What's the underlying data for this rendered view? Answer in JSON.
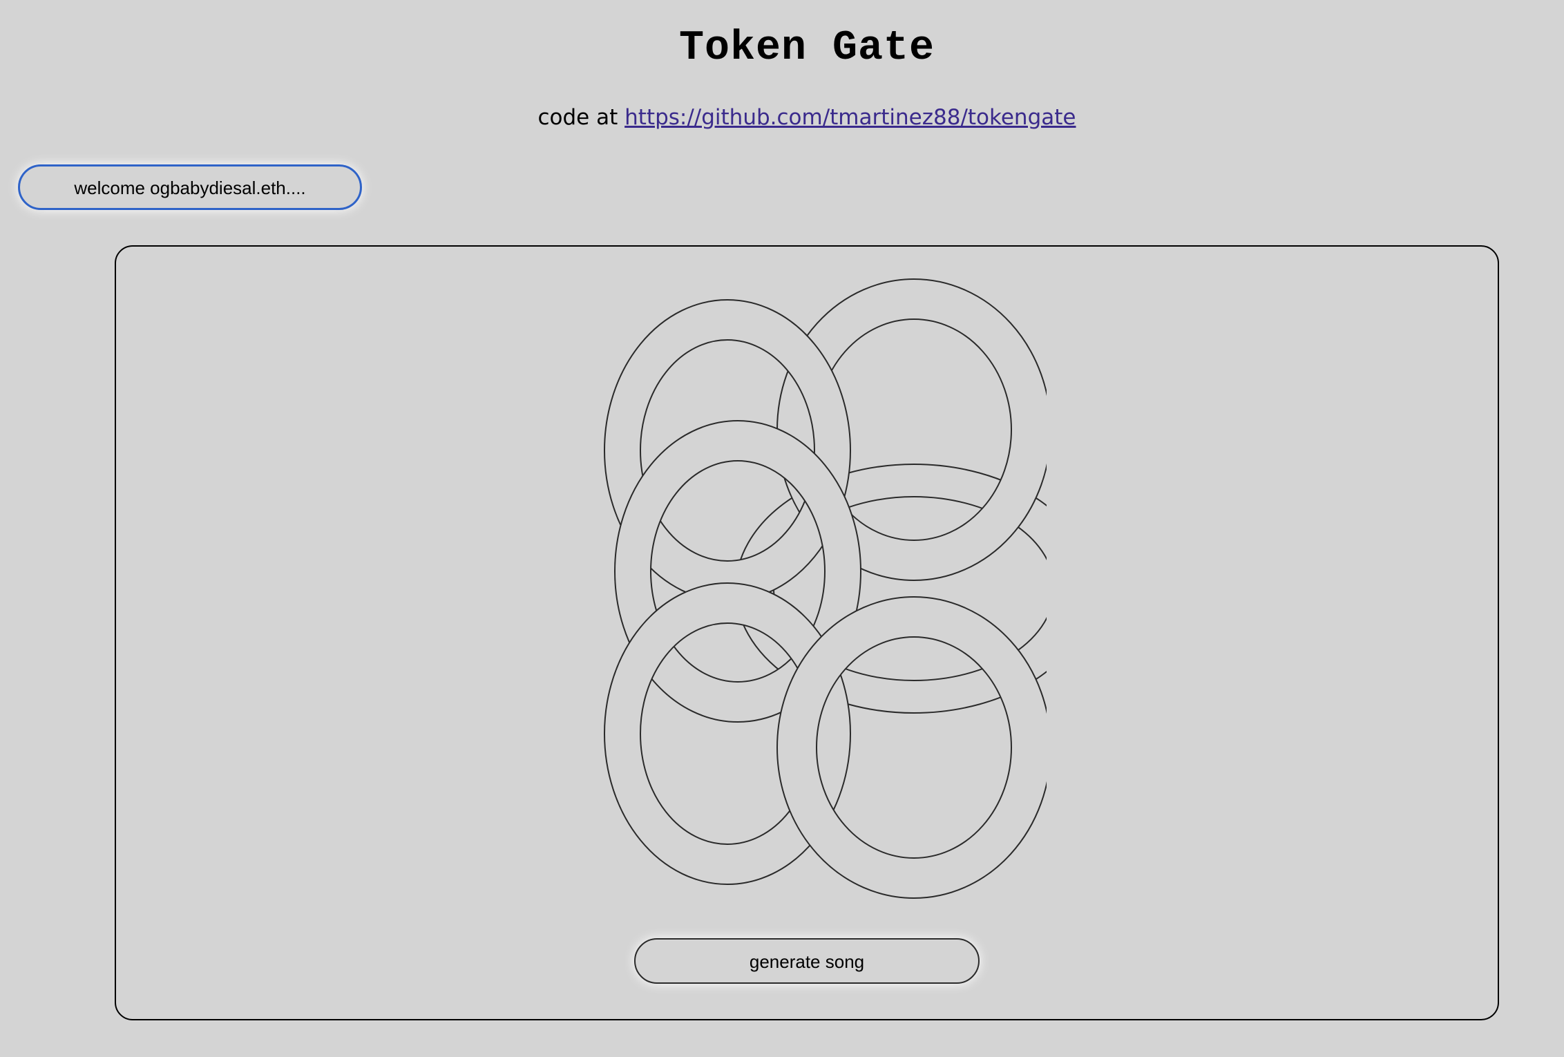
{
  "header": {
    "title": "Token Gate",
    "code_prefix": "code at",
    "repo_link": "https://github.com/tmartinez88/tokengate"
  },
  "account": {
    "welcome_label": "welcome ogbabydiesal.eth...."
  },
  "player": {
    "artwork_icon": "interlocking-rings-icon",
    "generate_label": "generate song"
  },
  "colors": {
    "background": "#d4d4d4",
    "link": "#3a2a8c",
    "welcome_border": "#2f63c8",
    "ring_stroke": "#2a2a2a"
  }
}
